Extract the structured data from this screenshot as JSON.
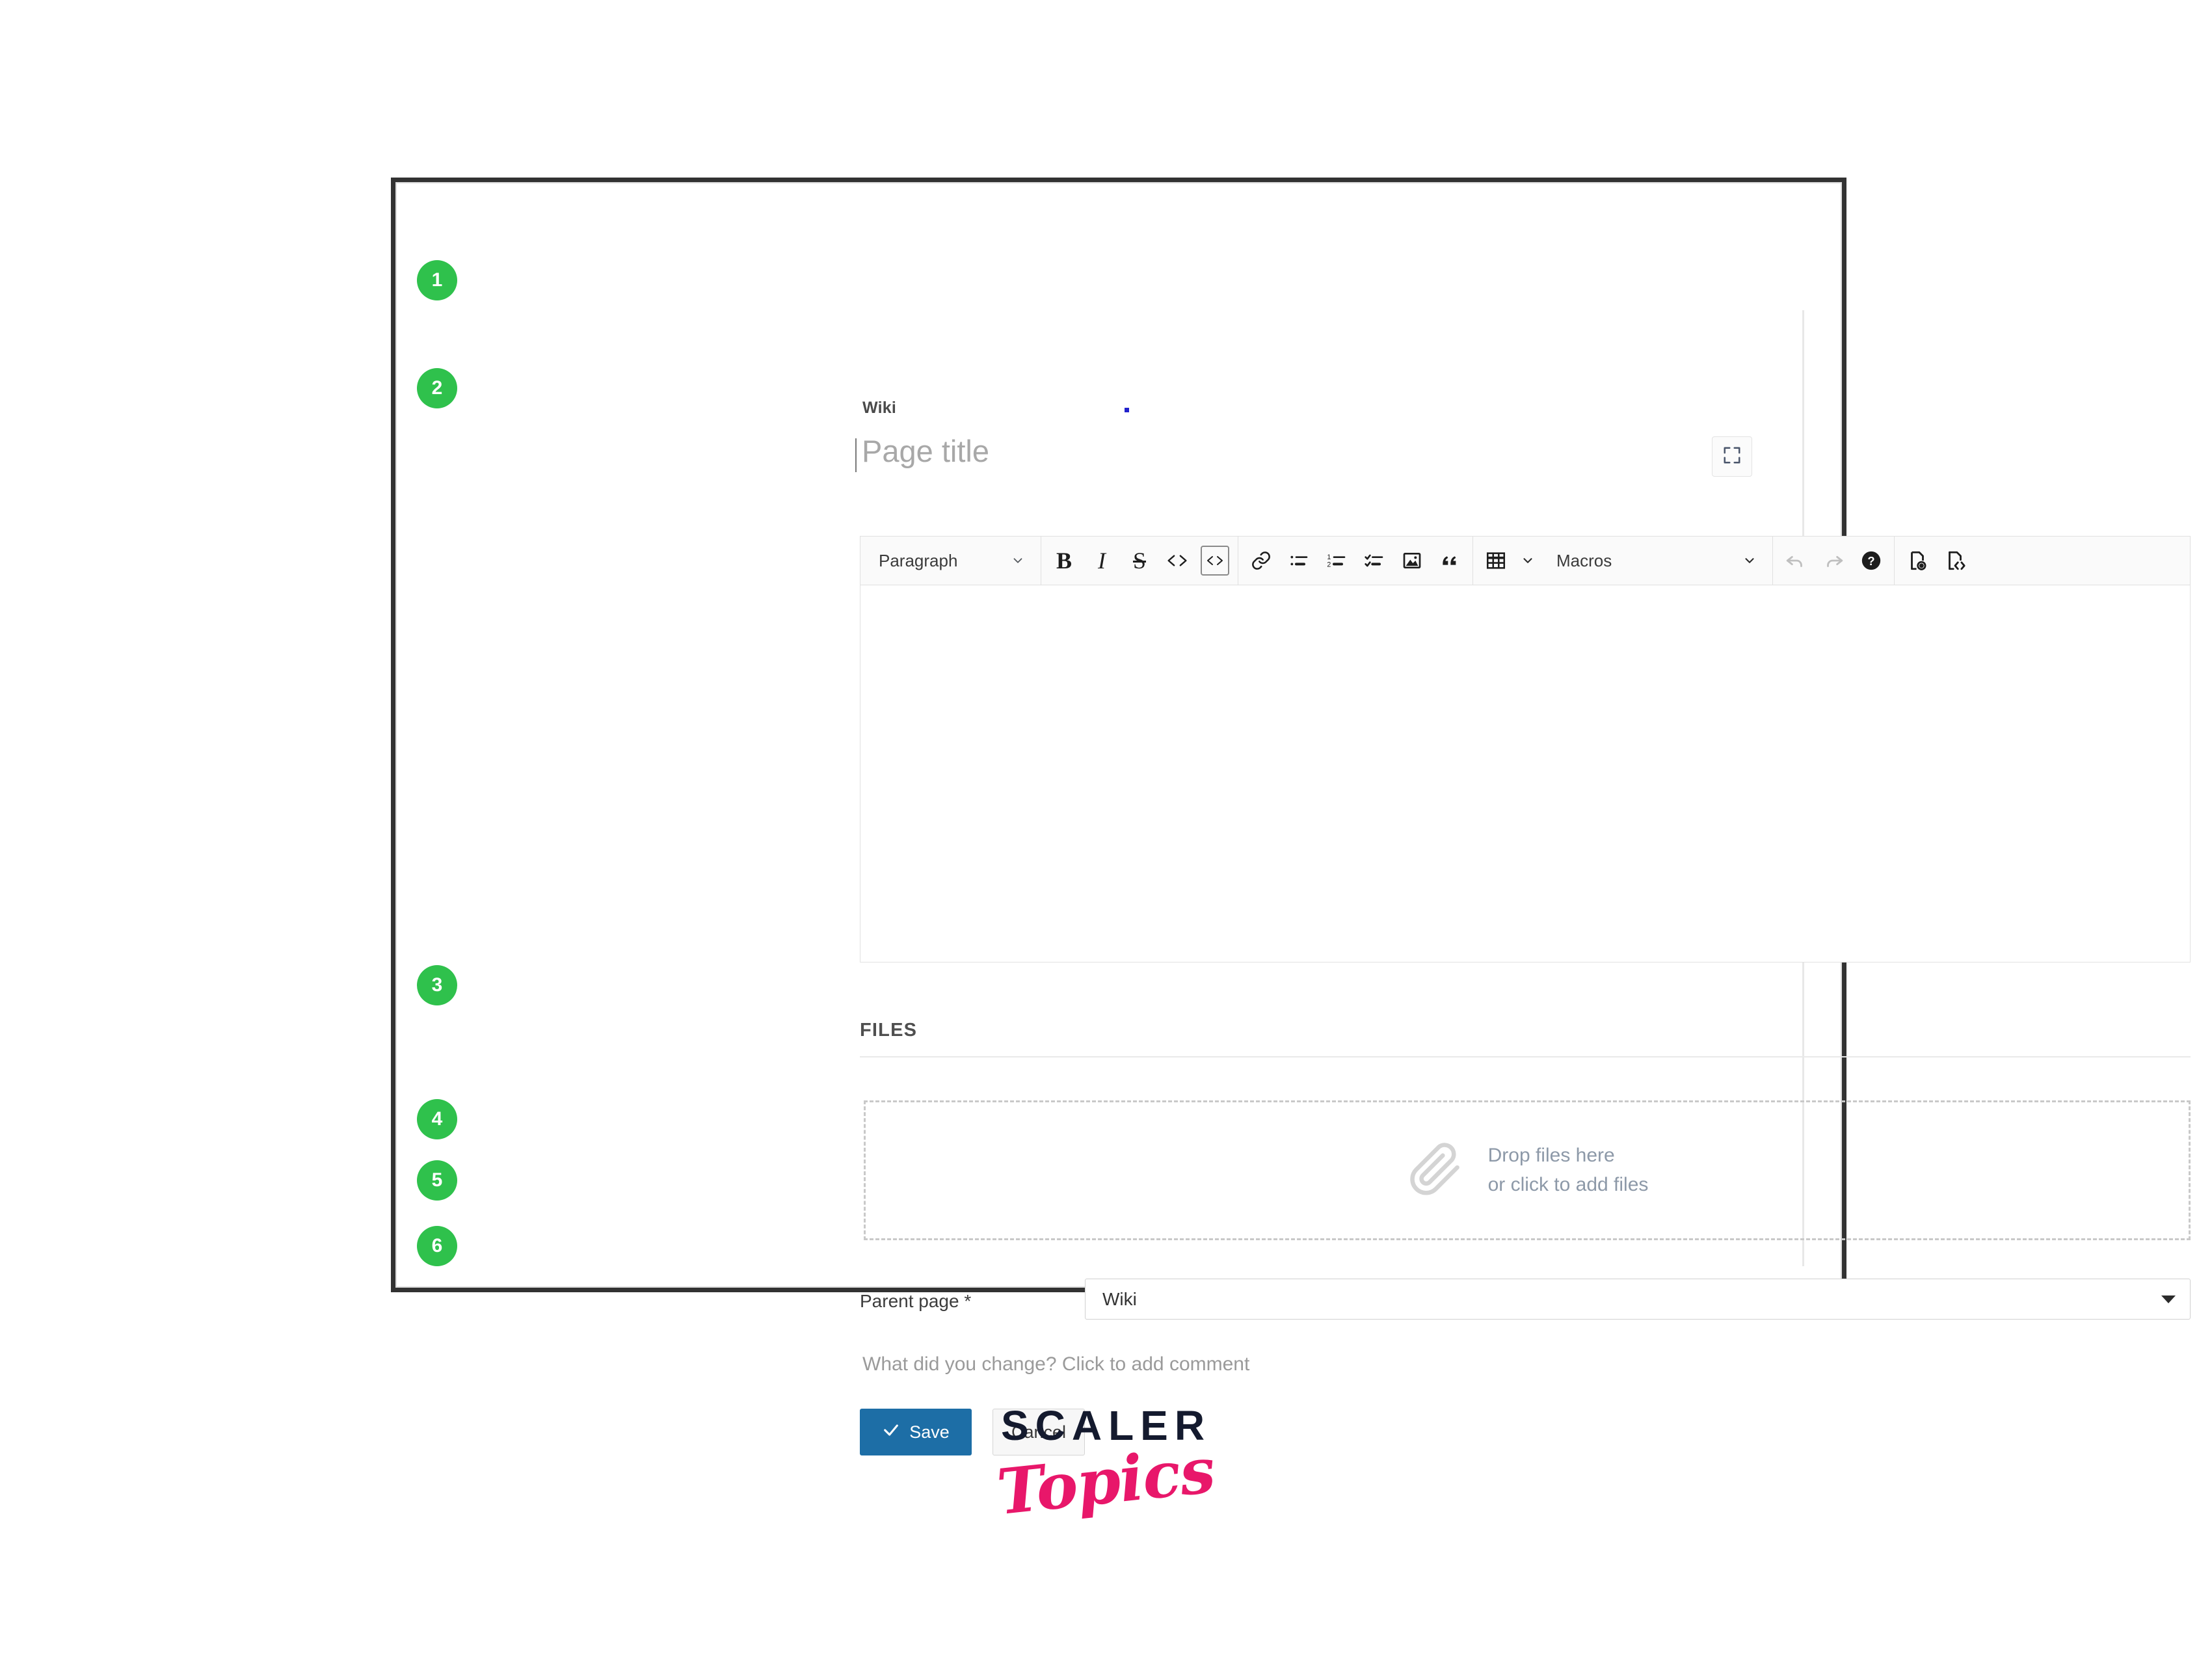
{
  "frame": {
    "breadcrumb": "Wiki",
    "title_placeholder": "Page title",
    "expand_icon": "fullscreen-expand-icon"
  },
  "steps": [
    {
      "number": "1",
      "target": "page-title"
    },
    {
      "number": "2",
      "target": "editor-toolbar"
    },
    {
      "number": "3",
      "target": "file-dropzone"
    },
    {
      "number": "4",
      "target": "parent-page"
    },
    {
      "number": "5",
      "target": "change-comment"
    },
    {
      "number": "6",
      "target": "save-button"
    }
  ],
  "toolbar": {
    "paragraph_label": "Paragraph",
    "macros_label": "Macros",
    "groups": [
      {
        "name": "block-format",
        "items": [
          {
            "icon": "paragraph-select",
            "label": "Paragraph"
          }
        ]
      },
      {
        "name": "inline-format",
        "items": [
          {
            "icon": "bold-icon",
            "label": "B"
          },
          {
            "icon": "italic-icon",
            "label": "I"
          },
          {
            "icon": "strikethrough-icon",
            "label": "S"
          },
          {
            "icon": "inline-code-icon",
            "label": "<>"
          },
          {
            "icon": "code-block-icon",
            "label": "<>"
          }
        ]
      },
      {
        "name": "insert",
        "items": [
          {
            "icon": "link-icon",
            "label": "Link"
          },
          {
            "icon": "bullet-list-icon",
            "label": "Bullet list"
          },
          {
            "icon": "numbered-list-icon",
            "label": "Numbered list"
          },
          {
            "icon": "task-list-icon",
            "label": "Task list"
          },
          {
            "icon": "image-icon",
            "label": "Image"
          },
          {
            "icon": "blockquote-icon",
            "label": "Blockquote"
          }
        ]
      },
      {
        "name": "table-macros",
        "items": [
          {
            "icon": "table-icon",
            "label": "Table"
          },
          {
            "icon": "macros-select",
            "label": "Macros"
          }
        ]
      },
      {
        "name": "history-help",
        "items": [
          {
            "icon": "undo-icon",
            "label": "Undo",
            "state": "disabled"
          },
          {
            "icon": "redo-icon",
            "label": "Redo",
            "state": "disabled"
          },
          {
            "icon": "help-icon",
            "label": "Help"
          }
        ]
      },
      {
        "name": "view-modes",
        "items": [
          {
            "icon": "preview-document-icon",
            "label": "Preview"
          },
          {
            "icon": "source-document-icon",
            "label": "Source"
          }
        ]
      }
    ]
  },
  "editor": {
    "body_content": ""
  },
  "files": {
    "heading": "FILES",
    "dropzone_icon": "paperclip-icon",
    "dropzone_line1": "Drop files here",
    "dropzone_line2": "or click to add files"
  },
  "parent_page": {
    "label": "Parent page",
    "required_marker": "*",
    "value": "Wiki",
    "caret_icon": "caret-down-icon"
  },
  "change_comment": {
    "placeholder": "What did you change? Click to add comment"
  },
  "actions": {
    "save_label": "Save",
    "save_icon": "check-icon",
    "cancel_label": "Cancel"
  },
  "logo": {
    "primary": "SCALER",
    "secondary": "Topics"
  },
  "colors": {
    "step_badge_green": "#2fc14c",
    "save_blue": "#1d6ea6",
    "logo_dark": "#141a2e",
    "logo_pink": "#e8176a",
    "frame_border": "#323232"
  }
}
